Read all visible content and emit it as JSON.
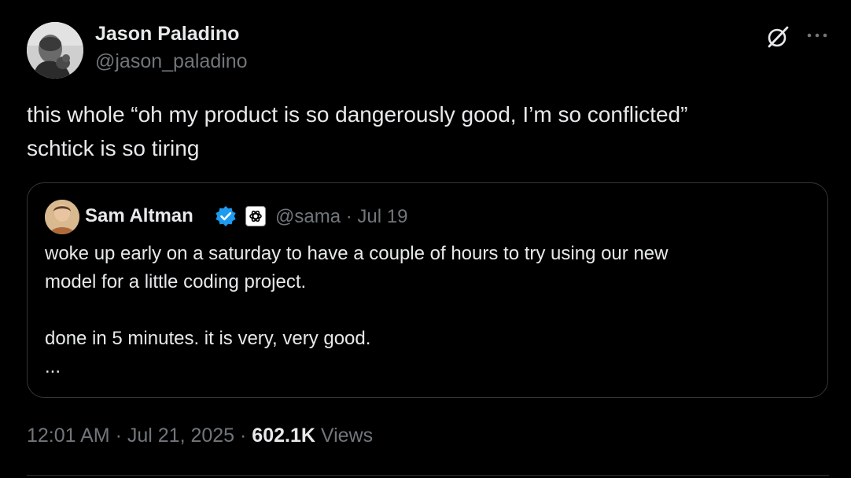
{
  "author": {
    "name": "Jason Paladino",
    "handle": "@jason_paladino"
  },
  "tweet": {
    "text": "this whole “oh my product is so dangerously good, I’m so conflicted”\nschtick is so tiring"
  },
  "quoted_tweet": {
    "name": "Sam Altman",
    "handle": "@sama",
    "separator": " · ",
    "date": "Jul 19",
    "text": "woke up early on a saturday to have a couple of hours to try using our new\nmodel for a little coding project.\n\ndone in 5 minutes. it is very, very good.\n...",
    "verified_color": "#1d9bf0"
  },
  "meta": {
    "time": "12:01 AM",
    "separator": " · ",
    "date": "Jul 21, 2025",
    "views_count": "602.1K",
    "views_label": "Views"
  },
  "icons": {
    "grok": "grok-icon",
    "more": "more-icon",
    "verified": "verified-icon",
    "org": "openai-logo-icon"
  },
  "colors": {
    "background": "#000000",
    "text_primary": "#e7e9ea",
    "text_secondary": "#71767b",
    "border": "#333639",
    "accent": "#1d9bf0"
  }
}
